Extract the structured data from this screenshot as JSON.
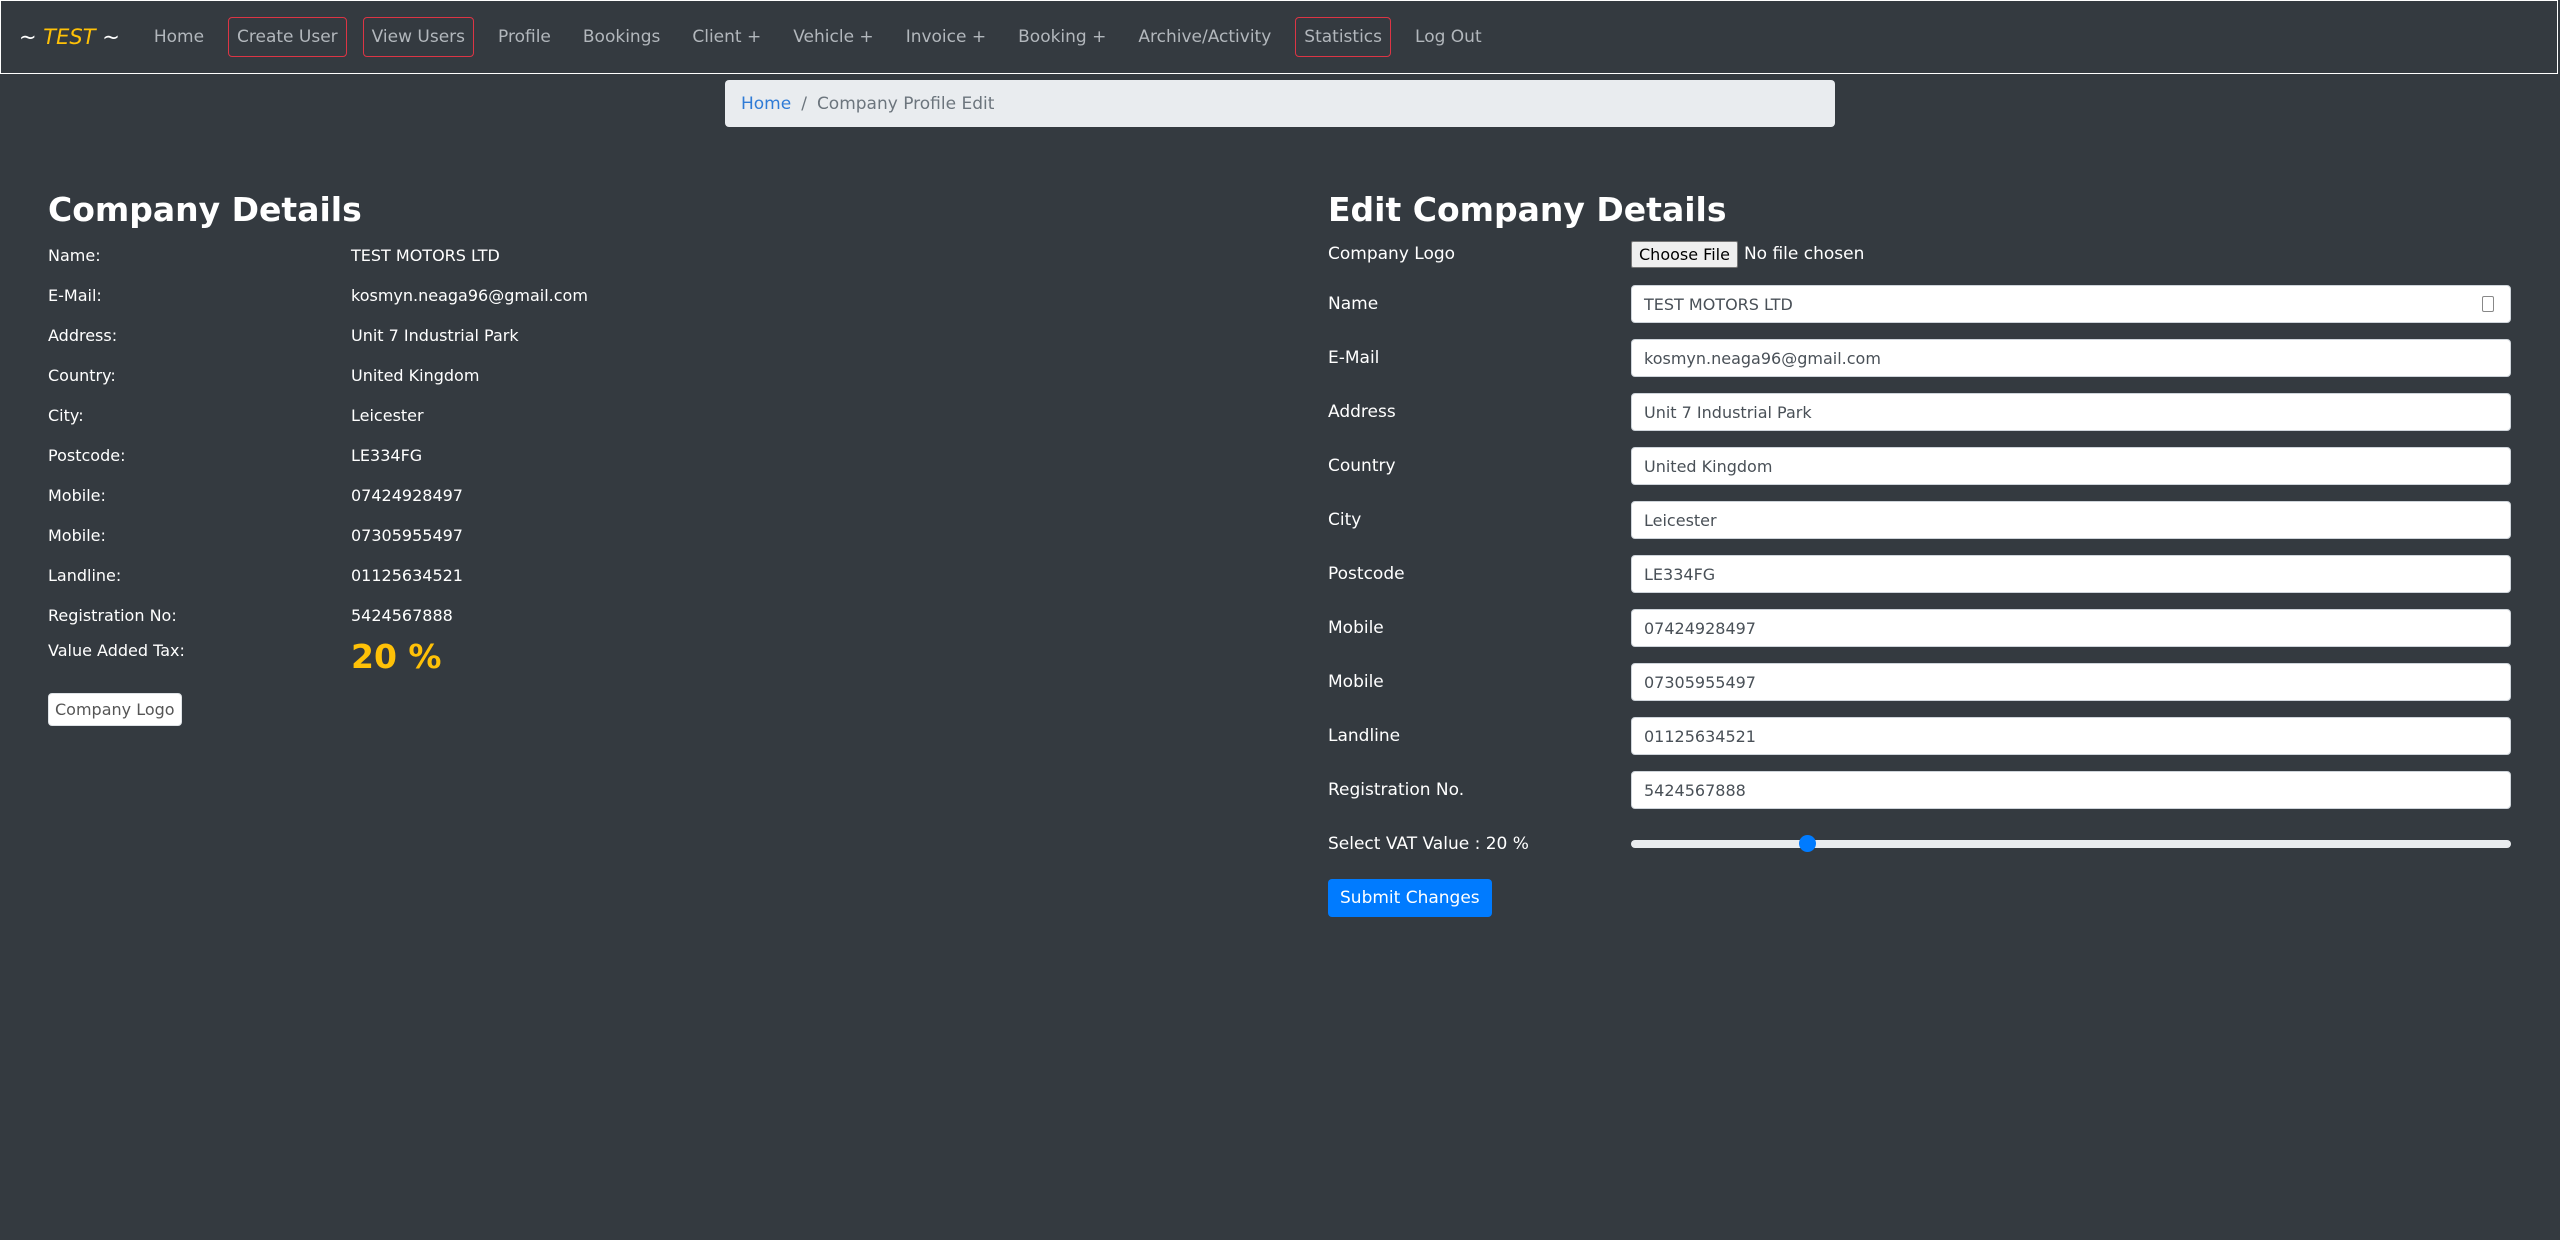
{
  "navbar": {
    "brand_prefix": "~ ",
    "brand": "TEST",
    "brand_suffix": " ~",
    "items": [
      {
        "label": "Home",
        "boxed": false
      },
      {
        "label": "Create User",
        "boxed": true
      },
      {
        "label": "View Users",
        "boxed": true
      },
      {
        "label": "Profile",
        "boxed": false
      },
      {
        "label": "Bookings",
        "boxed": false
      },
      {
        "label": "Client +",
        "boxed": false
      },
      {
        "label": "Vehicle +",
        "boxed": false
      },
      {
        "label": "Invoice +",
        "boxed": false
      },
      {
        "label": "Booking +",
        "boxed": false
      },
      {
        "label": "Archive/Activity",
        "boxed": false
      },
      {
        "label": "Statistics",
        "boxed": true
      },
      {
        "label": "Log Out",
        "boxed": false
      }
    ]
  },
  "breadcrumb": {
    "home": "Home",
    "separator": "/",
    "current": "Company Profile Edit"
  },
  "details": {
    "title": "Company Details",
    "rows": [
      {
        "label": "Name:",
        "value": "TEST MOTORS LTD"
      },
      {
        "label": "E-Mail:",
        "value": "kosmyn.neaga96@gmail.com"
      },
      {
        "label": "Address:",
        "value": "Unit 7 Industrial Park"
      },
      {
        "label": "Country:",
        "value": "United Kingdom"
      },
      {
        "label": "City:",
        "value": "Leicester"
      },
      {
        "label": "Postcode:",
        "value": "LE334FG"
      },
      {
        "label": "Mobile:",
        "value": "07424928497"
      },
      {
        "label": "Mobile:",
        "value": "07305955497"
      },
      {
        "label": "Landline:",
        "value": "01125634521"
      },
      {
        "label": "Registration No:",
        "value": "5424567888"
      }
    ],
    "vat_label": "Value Added Tax:",
    "vat_value": "20 %",
    "logo_alt": "Company Logo"
  },
  "edit": {
    "title": "Edit Company Details",
    "logo_label": "Company Logo",
    "file_button": "Choose File",
    "file_status": "No file chosen",
    "fields": [
      {
        "label": "Name",
        "value": "TEST MOTORS LTD"
      },
      {
        "label": "E-Mail",
        "value": "kosmyn.neaga96@gmail.com"
      },
      {
        "label": "Address",
        "value": "Unit 7 Industrial Park"
      },
      {
        "label": "Country",
        "value": "United Kingdom"
      },
      {
        "label": "City",
        "value": "Leicester"
      },
      {
        "label": "Postcode",
        "value": "LE334FG"
      },
      {
        "label": "Mobile",
        "value": "07424928497"
      },
      {
        "label": "Mobile",
        "value": "07305955497"
      },
      {
        "label": "Landline",
        "value": "01125634521"
      },
      {
        "label": "Registration No.",
        "value": "5424567888"
      }
    ],
    "vat_label": "Select VAT Value : 20 %",
    "vat_slider_fraction": 0.2,
    "submit": "Submit Changes"
  },
  "colors": {
    "background": "#343a40",
    "accent": "#ffc107",
    "primary": "#007bff",
    "danger": "#dc3545"
  }
}
